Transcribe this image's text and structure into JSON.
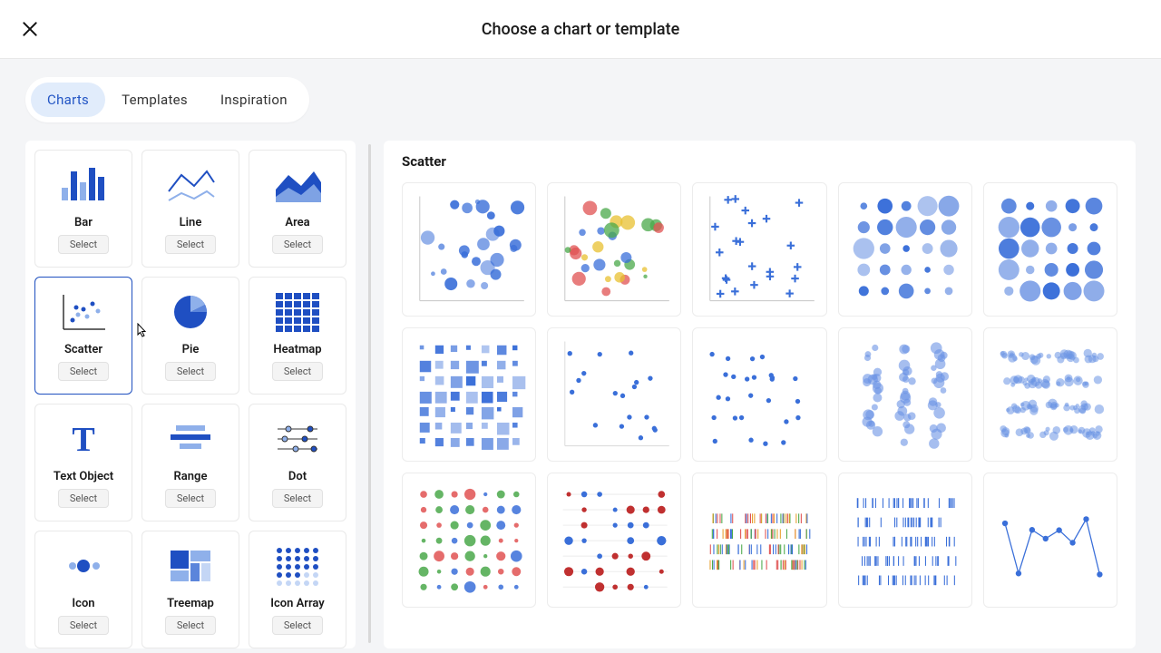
{
  "header": {
    "title": "Choose a chart or template"
  },
  "tabs": [
    {
      "label": "Charts",
      "active": true
    },
    {
      "label": "Templates",
      "active": false
    },
    {
      "label": "Inspiration",
      "active": false
    }
  ],
  "select_label": "Select",
  "chart_types": [
    {
      "id": "bar",
      "label": "Bar",
      "selected": false
    },
    {
      "id": "line",
      "label": "Line",
      "selected": false
    },
    {
      "id": "area",
      "label": "Area",
      "selected": false
    },
    {
      "id": "scatter",
      "label": "Scatter",
      "selected": true
    },
    {
      "id": "pie",
      "label": "Pie",
      "selected": false
    },
    {
      "id": "heatmap",
      "label": "Heatmap",
      "selected": false
    },
    {
      "id": "text",
      "label": "Text Object",
      "selected": false
    },
    {
      "id": "range",
      "label": "Range",
      "selected": false
    },
    {
      "id": "dot",
      "label": "Dot",
      "selected": false
    },
    {
      "id": "icon",
      "label": "Icon",
      "selected": false
    },
    {
      "id": "treemap",
      "label": "Treemap",
      "selected": false
    },
    {
      "id": "iconarray",
      "label": "Icon Array",
      "selected": false
    }
  ],
  "preview": {
    "title": "Scatter",
    "count": 15
  },
  "colors": {
    "primary": "#2356c5",
    "accent": "#4f7fe5",
    "light": "#a8c2f0"
  }
}
